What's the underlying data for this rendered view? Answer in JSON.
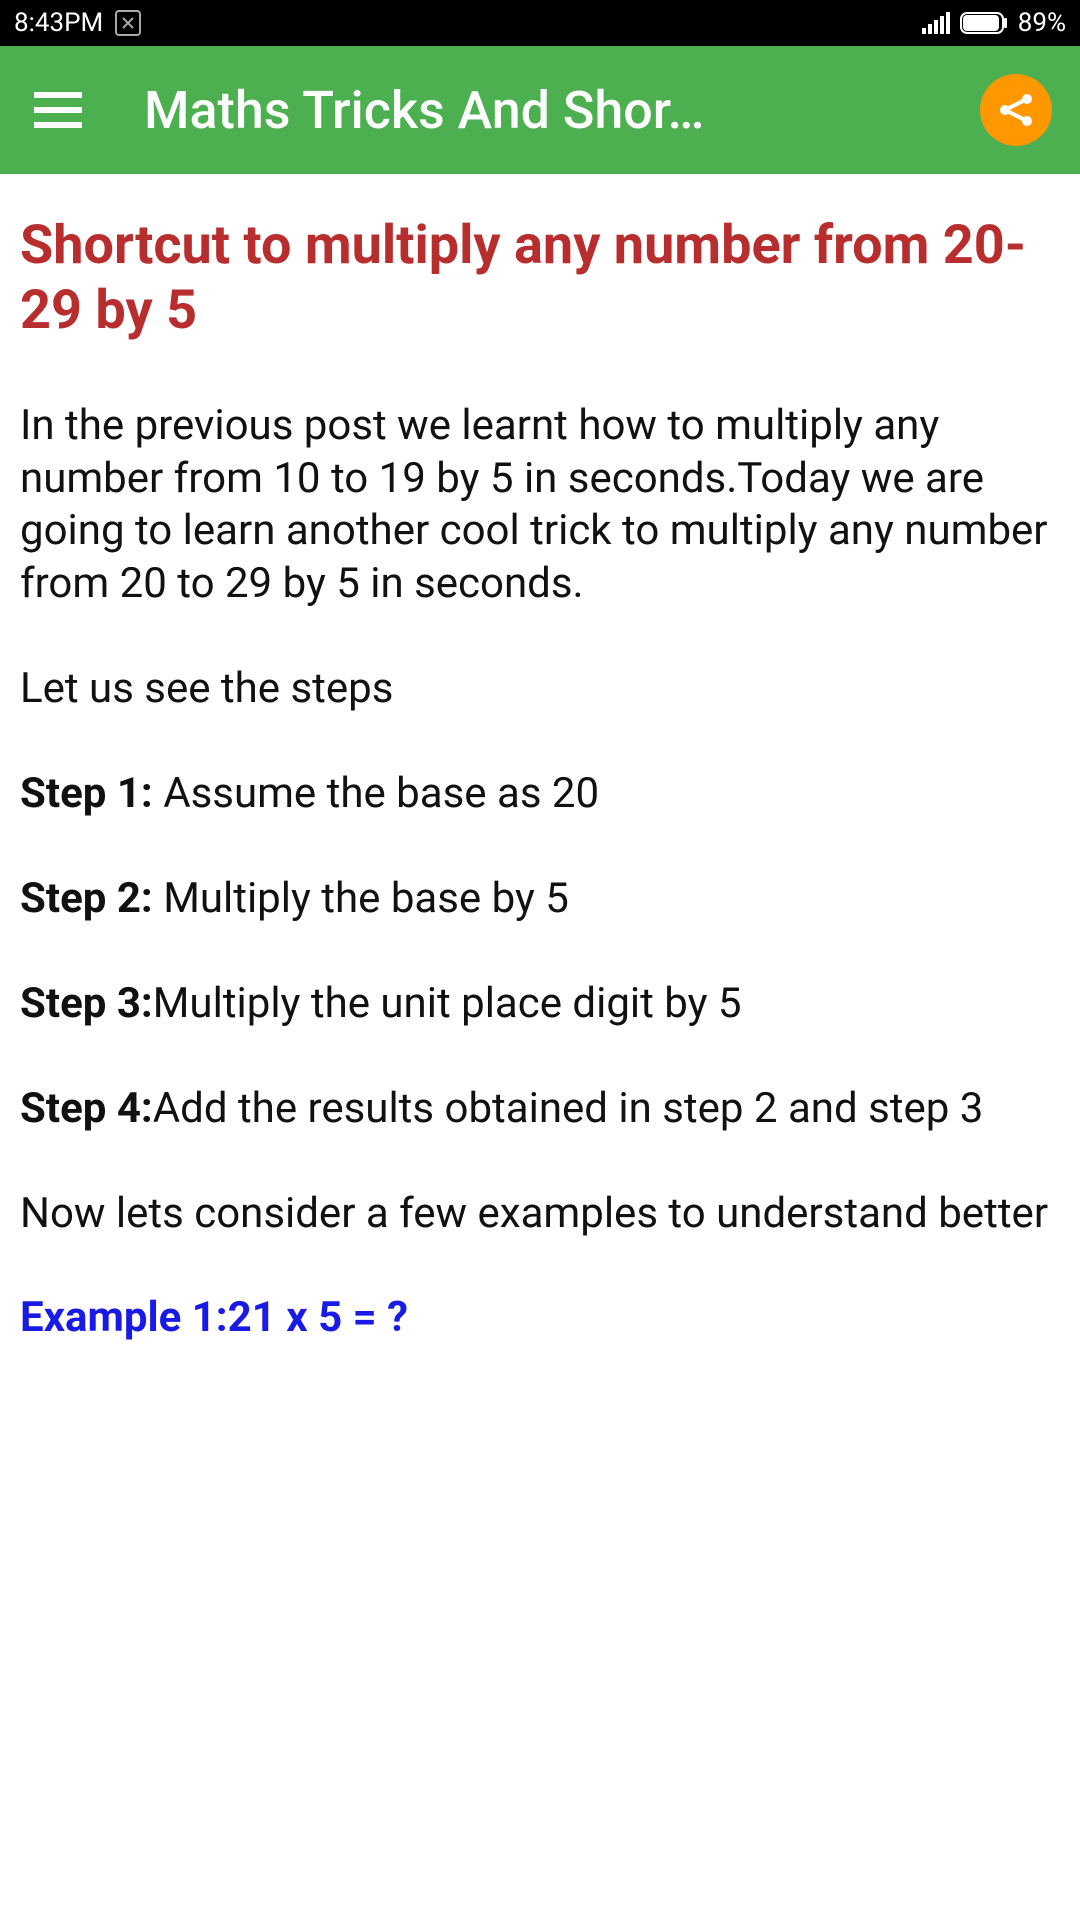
{
  "status_bar": {
    "time": "8:43PM",
    "battery_text": "89%"
  },
  "header": {
    "title": "Maths Tricks And Shor…"
  },
  "article": {
    "title": "Shortcut to multiply any number from 20-29 by 5",
    "intro": "In the previous post we learnt how to multiply any number from 10 to 19 by 5 in seconds.Today we are going to learn another cool trick to multiply any number from 20 to 29 by 5 in seconds.",
    "lead_in": "Let us see the steps",
    "steps": [
      {
        "label": "Step 1: ",
        "text": "Assume the base as 20"
      },
      {
        "label": "Step 2: ",
        "text": "Multiply the base by 5"
      },
      {
        "label": "Step 3:",
        "text": "Multiply the unit place digit by 5"
      },
      {
        "label": "Step 4:",
        "text": "Add the results obtained in step 2 and step 3"
      }
    ],
    "examples_lead": "Now lets consider a few examples to understand better",
    "example_partial": "Example 1:21 x 5 = ?"
  }
}
